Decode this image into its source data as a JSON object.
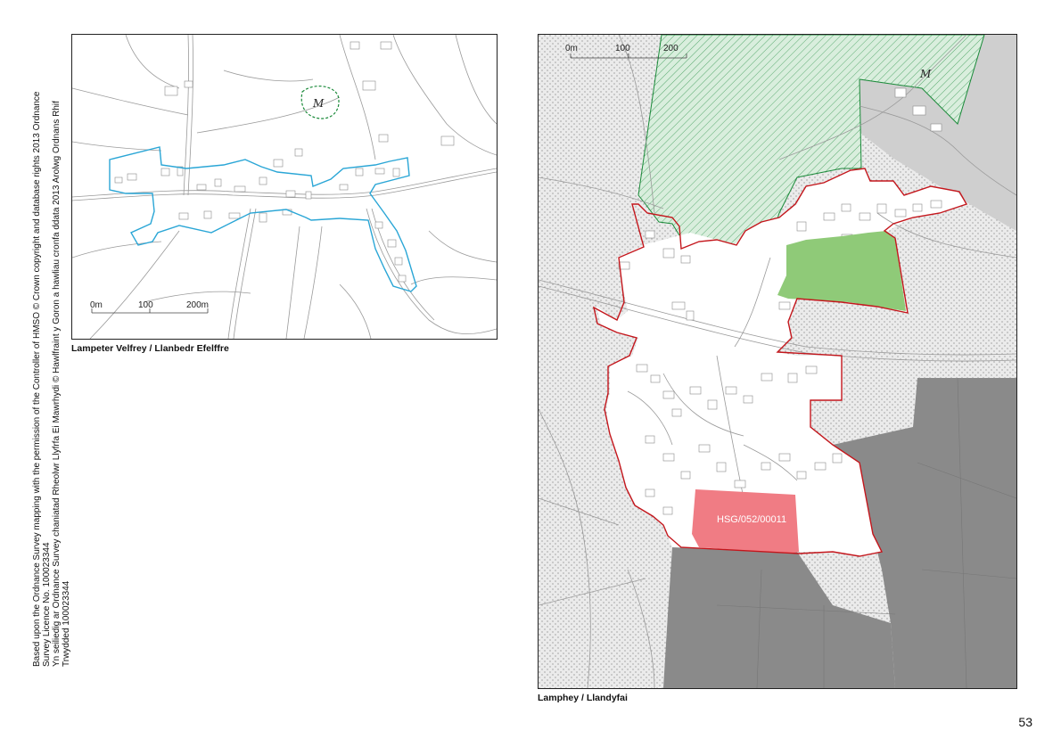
{
  "copyright": {
    "line1": "Based upon the Ordnance Survey mapping with the permission of the Controller of HMSO © Crown copyright and database rights 2013 Ordnance Survey Licence No. 100023344",
    "line2": "Yn seiliedig ar Ordnance Survey chaniatad Rheolwr Llyfrfa Ei Mawrhydi © Hawlfraint y Goron a hawliau cronfa ddata 2013 Arolwg Ordnans Rhif Trwydded 100023344"
  },
  "map_left": {
    "caption": "Lampeter Velfrey / Llanbedr Efelffre",
    "scale": [
      "0m",
      "100",
      "200m"
    ],
    "monument_symbol": "M",
    "colors": {
      "settlement_boundary": "#2aa6d6",
      "monument": "#1b8a3a",
      "roads": "#9a9a9a"
    }
  },
  "map_right": {
    "caption": "Lamphey / Llandyfai",
    "scale": [
      "0m",
      "100",
      "200"
    ],
    "monument_symbol": "M",
    "site_label": "HSG/052/00011",
    "colors": {
      "settlement_boundary": "#c4161c",
      "housing_allocation": "#f07c84",
      "green_space": "#8fca78",
      "hatched_area": "#1b8a3a",
      "stipple": "#e6e6e6",
      "dark_zone": "#8a8a8a",
      "light_grey_zone": "#cfcfcf"
    }
  },
  "page": {
    "number": "53"
  }
}
